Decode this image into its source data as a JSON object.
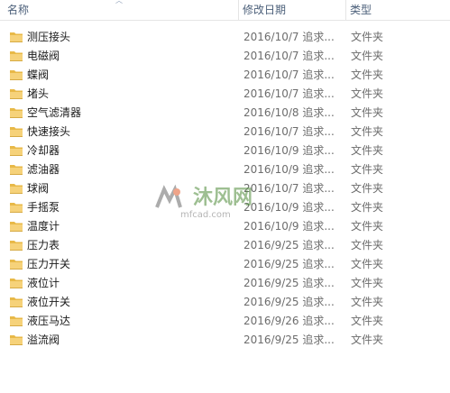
{
  "columns": {
    "name": "名称",
    "date": "修改日期",
    "type": "类型"
  },
  "files": [
    {
      "name": "测压接头",
      "date": "2016/10/7 追求...",
      "type": "文件夹"
    },
    {
      "name": "电磁阀",
      "date": "2016/10/7 追求...",
      "type": "文件夹"
    },
    {
      "name": "蝶阀",
      "date": "2016/10/7 追求...",
      "type": "文件夹"
    },
    {
      "name": "堵头",
      "date": "2016/10/7 追求...",
      "type": "文件夹"
    },
    {
      "name": "空气滤清器",
      "date": "2016/10/8 追求...",
      "type": "文件夹"
    },
    {
      "name": "快速接头",
      "date": "2016/10/7 追求...",
      "type": "文件夹"
    },
    {
      "name": "冷却器",
      "date": "2016/10/9 追求...",
      "type": "文件夹"
    },
    {
      "name": "滤油器",
      "date": "2016/10/9 追求...",
      "type": "文件夹"
    },
    {
      "name": "球阀",
      "date": "2016/10/7 追求...",
      "type": "文件夹"
    },
    {
      "name": "手摇泵",
      "date": "2016/10/9 追求...",
      "type": "文件夹"
    },
    {
      "name": "温度计",
      "date": "2016/10/9 追求...",
      "type": "文件夹"
    },
    {
      "name": "压力表",
      "date": "2016/9/25 追求...",
      "type": "文件夹"
    },
    {
      "name": "压力开关",
      "date": "2016/9/25 追求...",
      "type": "文件夹"
    },
    {
      "name": "液位计",
      "date": "2016/9/25 追求...",
      "type": "文件夹"
    },
    {
      "name": "液位开关",
      "date": "2016/9/25 追求...",
      "type": "文件夹"
    },
    {
      "name": "液压马达",
      "date": "2016/9/26 追求...",
      "type": "文件夹"
    },
    {
      "name": "溢流阀",
      "date": "2016/9/25 追求...",
      "type": "文件夹"
    }
  ],
  "icons": {
    "folder": "folder-icon",
    "sort": "sort-arrow-icon"
  },
  "colors": {
    "folder_body": "#e8b948",
    "folder_front": "#f6d27a",
    "header_text": "#4c607a",
    "meta_text": "#6d6d6d"
  },
  "watermark": {
    "brand_cn": "沐风网",
    "domain": "mfcad.com"
  }
}
